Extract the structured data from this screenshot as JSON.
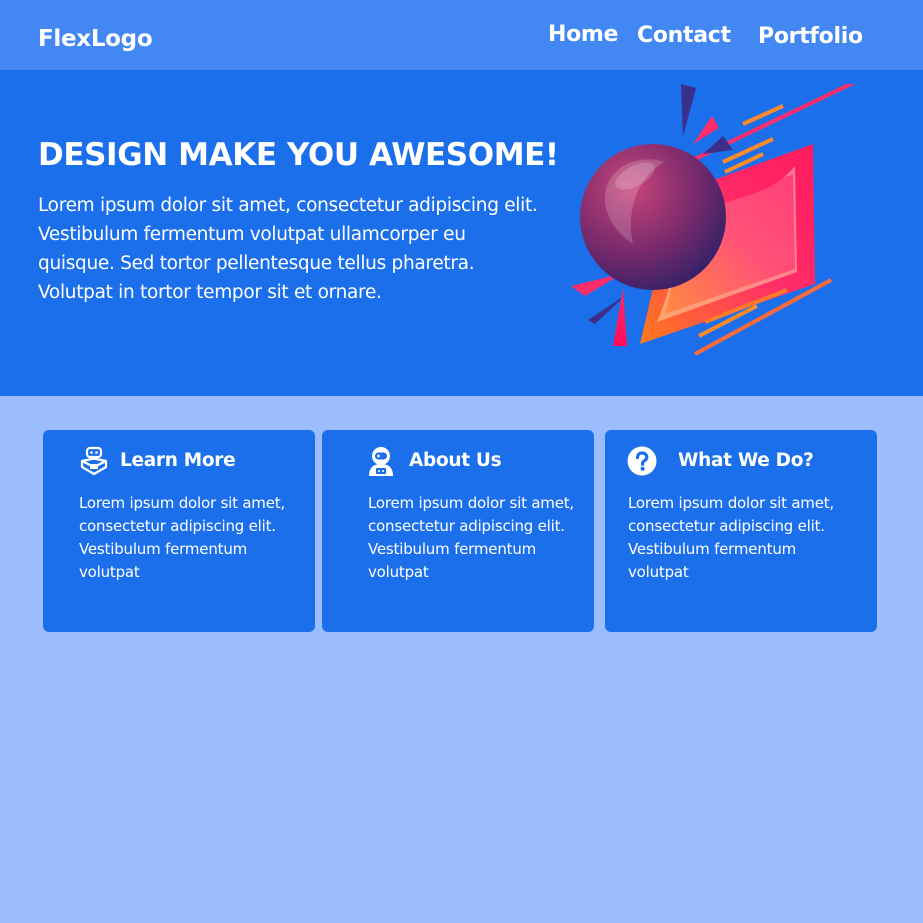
{
  "header": {
    "logo": "FlexLogo",
    "nav": [
      {
        "label": "Home"
      },
      {
        "label": "Contact"
      },
      {
        "label": "Portfolio"
      }
    ]
  },
  "hero": {
    "title": "DESIGN MAKE YOU AWESOME!",
    "text": "Lorem ipsum dolor sit amet, consectetur adipiscing elit. Vestibulum fermentum volutpat ullamcorper eu quisque. Sed tortor pellentesque tellus pharetra. Volutpat in tortor tempor sit et ornare."
  },
  "cards": [
    {
      "icon": "robot-icon",
      "title": "Learn More",
      "text": "Lorem ipsum dolor sit amet, consectetur adipiscing elit. Vestibulum fermentum volutpat"
    },
    {
      "icon": "astronaut-icon",
      "title": "About Us",
      "text": "Lorem ipsum dolor sit amet, consectetur adipiscing elit. Vestibulum fermentum volutpat"
    },
    {
      "icon": "question-circle-icon",
      "title": "What We Do?",
      "text": "Lorem ipsum dolor sit amet, consectetur adipiscing elit. Vestibulum fermentum volutpat"
    }
  ],
  "colors": {
    "nav_bg": "#4388f2",
    "hero_bg": "#1c6fea",
    "page_bg": "#9bbcfd",
    "card_bg": "#1c6fea",
    "text": "#ffffff"
  }
}
